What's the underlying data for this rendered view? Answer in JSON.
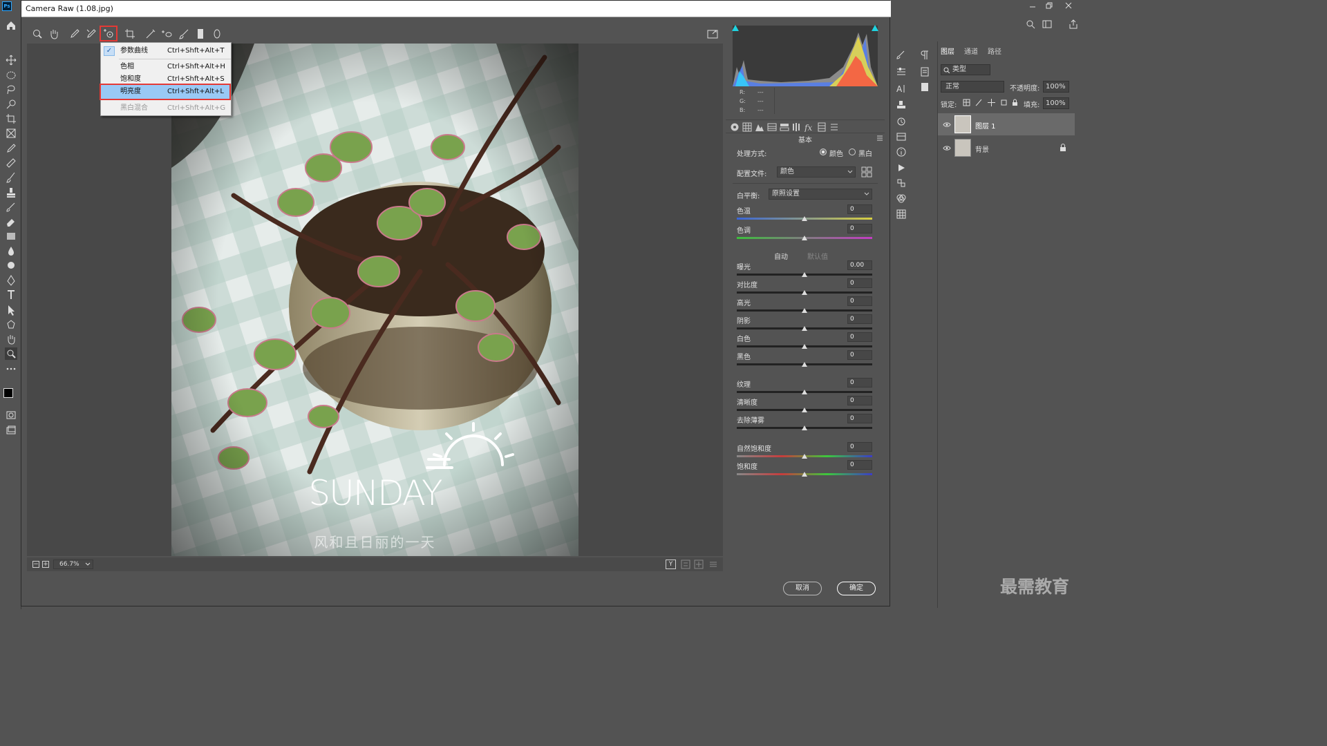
{
  "app": {
    "logo": "Ps",
    "window_title": "Camera Raw (1.08.jpg)"
  },
  "context_menu": {
    "items": [
      {
        "label": "参数曲线",
        "shortcut": "Ctrl+Shft+Alt+T",
        "checked": true
      },
      {
        "label": "色相",
        "shortcut": "Ctrl+Shft+Alt+H"
      },
      {
        "label": "饱和度",
        "shortcut": "Ctrl+Shft+Alt+S"
      },
      {
        "label": "明亮度",
        "shortcut": "Ctrl+Shft+Alt+L",
        "selected": true
      },
      {
        "label": "黑白混合",
        "shortcut": "Ctrl+Shft+Alt+G",
        "disabled": true
      }
    ]
  },
  "photo": {
    "overlay_title": "SUNDAY",
    "overlay_subtitle": "风和且日丽的一天"
  },
  "zoom": {
    "value": "66.7%"
  },
  "histogram": {
    "r_label": "R:",
    "g_label": "G:",
    "b_label": "B:",
    "r": "---",
    "g": "---",
    "b": "---"
  },
  "basic": {
    "section_title": "基本",
    "treatment_label": "处理方式:",
    "treatment_color": "颜色",
    "treatment_bw": "黑白",
    "profile_label": "配置文件:",
    "profile_value": "颜色",
    "wb_label": "白平衡:",
    "wb_value": "原照设置",
    "auto": "自动",
    "default": "默认值",
    "sliders": [
      {
        "label": "色温",
        "value": "0"
      },
      {
        "label": "色调",
        "value": "0"
      },
      {
        "label": "曝光",
        "value": "0.00"
      },
      {
        "label": "对比度",
        "value": "0"
      },
      {
        "label": "高光",
        "value": "0"
      },
      {
        "label": "阴影",
        "value": "0"
      },
      {
        "label": "白色",
        "value": "0"
      },
      {
        "label": "黑色",
        "value": "0"
      },
      {
        "label": "纹理",
        "value": "0"
      },
      {
        "label": "清晰度",
        "value": "0"
      },
      {
        "label": "去除薄雾",
        "value": "0"
      },
      {
        "label": "自然饱和度",
        "value": "0"
      },
      {
        "label": "饱和度",
        "value": "0"
      }
    ]
  },
  "buttons": {
    "cancel": "取消",
    "ok": "确定"
  },
  "layers_panel": {
    "tabs": [
      "图层",
      "通道",
      "路径"
    ],
    "kind_filter": "类型",
    "blend_mode": "正常",
    "opacity_label": "不透明度:",
    "opacity_value": "100%",
    "lock_label": "锁定:",
    "fill_label": "填充:",
    "fill_value": "100%",
    "layers": [
      {
        "name": "图层 1"
      },
      {
        "name": "背景"
      }
    ]
  },
  "watermark": "最需教育",
  "colors": {
    "accent": "#99c9f5",
    "highlight_box": "#e53935",
    "ok_border": "#ffffff"
  }
}
